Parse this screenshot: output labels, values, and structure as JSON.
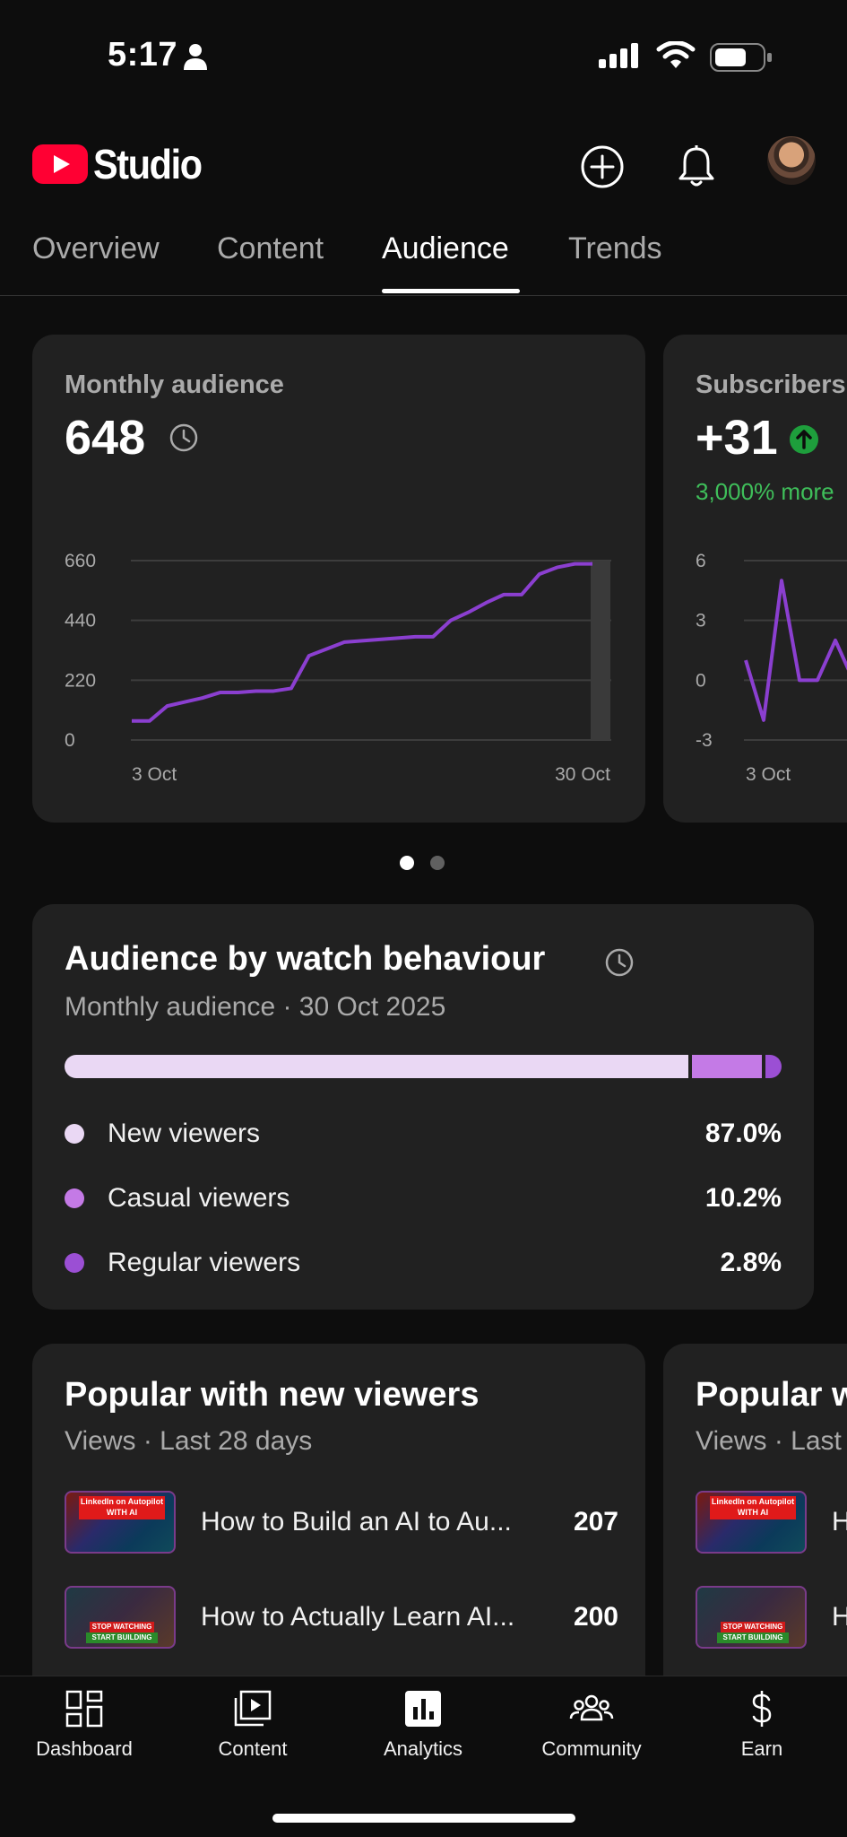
{
  "status": {
    "time": "5:17"
  },
  "header": {
    "brand": "Studio"
  },
  "tabs": [
    {
      "label": "Overview"
    },
    {
      "label": "Content"
    },
    {
      "label": "Audience"
    },
    {
      "label": "Trends"
    }
  ],
  "cards": {
    "monthly": {
      "label": "Monthly audience",
      "value": "648"
    },
    "subscribers": {
      "label": "Subscribers",
      "value": "+31",
      "change": "3,000% more"
    }
  },
  "chart_data": [
    {
      "type": "line",
      "title": "Monthly audience",
      "x_start": "3 Oct",
      "x_end": "30 Oct",
      "x_ticks": [
        "3 Oct",
        "30 Oct"
      ],
      "y_ticks": [
        0,
        220,
        440,
        660
      ],
      "ylim": [
        0,
        660
      ],
      "values": [
        70,
        70,
        125,
        140,
        155,
        175,
        175,
        180,
        180,
        190,
        310,
        335,
        360,
        365,
        370,
        375,
        380,
        380,
        440,
        470,
        505,
        535,
        535,
        610,
        635,
        648,
        648
      ],
      "color": "#8b3fd0",
      "grid": true
    },
    {
      "type": "line",
      "title": "Subscribers",
      "x_ticks": [
        "3 Oct"
      ],
      "y_ticks": [
        -3,
        0,
        3,
        6
      ],
      "ylim": [
        -3,
        6
      ],
      "values": [
        1,
        -2,
        5,
        0,
        0,
        2,
        0
      ],
      "color": "#8b3fd0",
      "grid": true
    }
  ],
  "watch": {
    "title": "Audience by watch behaviour",
    "subtitle": "Monthly audience · 30 Oct 2025",
    "segments": [
      {
        "name": "New viewers",
        "pct": "87.0%",
        "share": 87.0,
        "color": "#ead8f4"
      },
      {
        "name": "Casual viewers",
        "pct": "10.2%",
        "share": 10.2,
        "color": "#c47ae6"
      },
      {
        "name": "Regular viewers",
        "pct": "2.8%",
        "share": 2.8,
        "color": "#9b4fd4"
      }
    ]
  },
  "popular": {
    "title": "Popular with new viewers",
    "subtitle": "Views · Last 28 days",
    "videos": [
      {
        "title": "How to Build an AI to Au...",
        "views": "207",
        "thumb_text": "LinkedIn on Autopilot WITH AI"
      },
      {
        "title": "How to Actually Learn AI...",
        "views": "200",
        "thumb_text_top": "STOP WATCHING",
        "thumb_text_bottom": "START BUILDING"
      }
    ]
  },
  "popular2": {
    "title": "Popular w",
    "subtitle": "Views · Last",
    "videos": [
      {
        "title": "H",
        "thumb_text": "LinkedIn on Autopilot WITH AI"
      },
      {
        "title": "H",
        "thumb_text_top": "STOP WATCHING",
        "thumb_text_bottom": "START BUILDING"
      }
    ]
  },
  "nav": [
    {
      "label": "Dashboard",
      "icon": "dashboard-icon"
    },
    {
      "label": "Content",
      "icon": "content-icon"
    },
    {
      "label": "Analytics",
      "icon": "analytics-icon"
    },
    {
      "label": "Community",
      "icon": "community-icon"
    },
    {
      "label": "Earn",
      "icon": "earn-icon"
    }
  ]
}
